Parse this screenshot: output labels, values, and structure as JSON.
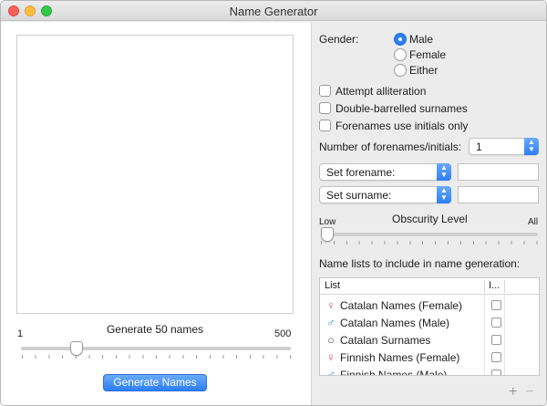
{
  "window": {
    "title": "Name Generator"
  },
  "generator": {
    "label": "Generate 50 names",
    "min_label": "1",
    "max_label": "500",
    "count": 50,
    "min": 1,
    "max": 500,
    "button_label": "Generate Names"
  },
  "settings": {
    "gender_label": "Gender:",
    "gender_options": [
      "Male",
      "Female",
      "Either"
    ],
    "gender_selected": "Male",
    "alliteration_label": "Attempt alliteration",
    "double_barrelled_label": "Double-barrelled surnames",
    "initials_label": "Forenames use initials only",
    "forenames_count_label": "Number of forenames/initials:",
    "forenames_count_value": "1",
    "forename_popup": "Set forename:",
    "forename_value": "",
    "surname_popup": "Set surname:",
    "surname_value": "",
    "obscurity_title": "Obscurity Level",
    "obscurity_min": "Low",
    "obscurity_max": "All",
    "obscurity_level": 0
  },
  "name_lists": {
    "heading": "Name lists to include in name generation:",
    "columns": [
      "List",
      "I..."
    ],
    "rows": [
      {
        "icon": "female-icon",
        "glyph": "♀",
        "color": "#e0457a",
        "name": "Catalan Names (Female)"
      },
      {
        "icon": "male-icon",
        "glyph": "♂",
        "color": "#3f8fd8",
        "name": "Catalan Names (Male)"
      },
      {
        "icon": "neutral-icon",
        "glyph": "○",
        "color": "#555555",
        "name": "Catalan Surnames"
      },
      {
        "icon": "female-icon",
        "glyph": "♀",
        "color": "#e0457a",
        "name": "Finnish Names (Female)"
      },
      {
        "icon": "male-icon",
        "glyph": "♂",
        "color": "#3f8fd8",
        "name": "Finnish Names (Male)"
      }
    ]
  },
  "colors": {
    "accent": "#2d7ef5"
  }
}
